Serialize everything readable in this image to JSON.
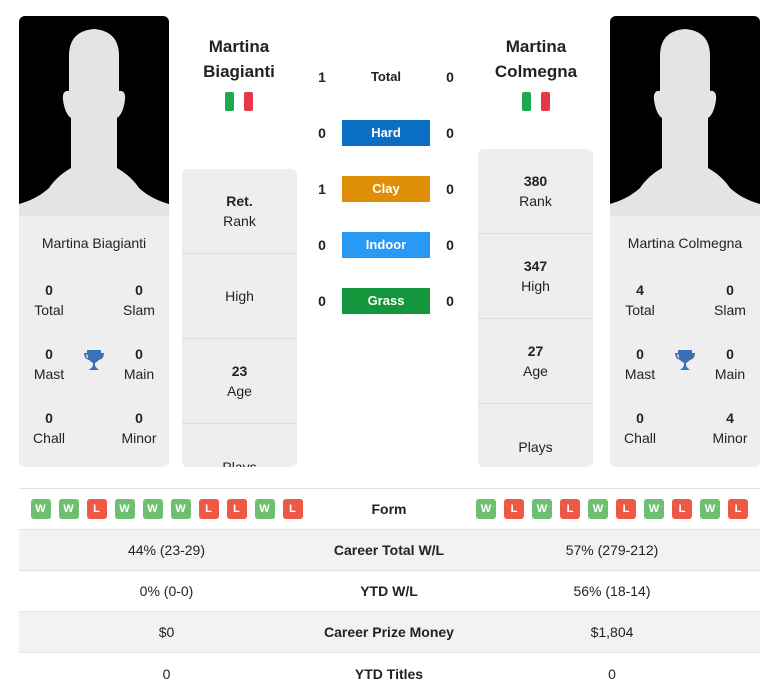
{
  "colors": {
    "hard": "#0a6fc4",
    "clay": "#de8f06",
    "indoor": "#2899f5",
    "grass": "#14973c",
    "win": "#6fbf73",
    "loss": "#ec5a46",
    "trophy": "#3b6fb6"
  },
  "player1": {
    "name_line1": "Martina",
    "name_line2": "Biagianti",
    "full_name": "Martina Biagianti",
    "country": "Italy",
    "titles": {
      "total": "0",
      "total_label": "Total",
      "slam": "0",
      "slam_label": "Slam",
      "mast": "0",
      "mast_label": "Mast",
      "main": "0",
      "main_label": "Main",
      "chall": "0",
      "chall_label": "Chall",
      "minor": "0",
      "minor_label": "Minor"
    },
    "rank": {
      "value": "Ret.",
      "label": "Rank"
    },
    "high": {
      "value": "",
      "label": "High"
    },
    "age": {
      "value": "23",
      "label": "Age"
    },
    "plays": {
      "value": "",
      "label": "Plays"
    },
    "form": [
      "W",
      "W",
      "L",
      "W",
      "W",
      "W",
      "L",
      "L",
      "W",
      "L"
    ]
  },
  "player2": {
    "name_line1": "Martina",
    "name_line2": "Colmegna",
    "full_name": "Martina Colmegna",
    "country": "Italy",
    "titles": {
      "total": "4",
      "total_label": "Total",
      "slam": "0",
      "slam_label": "Slam",
      "mast": "0",
      "mast_label": "Mast",
      "main": "0",
      "main_label": "Main",
      "chall": "0",
      "chall_label": "Chall",
      "minor": "4",
      "minor_label": "Minor"
    },
    "rank": {
      "value": "380",
      "label": "Rank"
    },
    "high": {
      "value": "347",
      "label": "High"
    },
    "age": {
      "value": "27",
      "label": "Age"
    },
    "plays": {
      "value": "",
      "label": "Plays"
    },
    "form": [
      "W",
      "L",
      "W",
      "L",
      "W",
      "L",
      "W",
      "L",
      "W",
      "L"
    ]
  },
  "h2h": [
    {
      "surface": "Total",
      "p1": "1",
      "p2": "0"
    },
    {
      "surface": "Hard",
      "p1": "0",
      "p2": "0"
    },
    {
      "surface": "Clay",
      "p1": "1",
      "p2": "0"
    },
    {
      "surface": "Indoor",
      "p1": "0",
      "p2": "0"
    },
    {
      "surface": "Grass",
      "p1": "0",
      "p2": "0"
    }
  ],
  "stats": {
    "form_label": "Form",
    "rows": [
      {
        "label": "Career Total W/L",
        "p1": "44% (23-29)",
        "p2": "57% (279-212)"
      },
      {
        "label": "YTD W/L",
        "p1": "0% (0-0)",
        "p2": "56% (18-14)"
      },
      {
        "label": "Career Prize Money",
        "p1": "$0",
        "p2": "$1,804"
      },
      {
        "label": "YTD Titles",
        "p1": "0",
        "p2": "0"
      }
    ]
  }
}
